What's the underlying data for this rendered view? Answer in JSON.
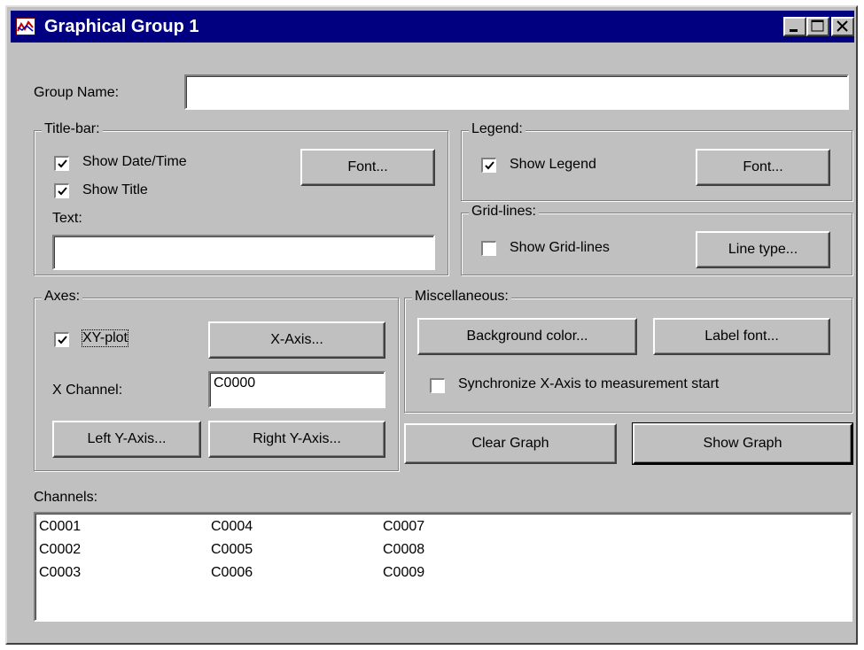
{
  "window": {
    "title": "Graphical Group 1",
    "minimize": "_",
    "maximize": "□",
    "close": "×"
  },
  "group_name": {
    "label": "Group Name:",
    "value": ""
  },
  "titlebar_group": {
    "title": "Title-bar:",
    "show_datetime": {
      "label": "Show Date/Time",
      "checked": true
    },
    "show_title": {
      "label": "Show Title",
      "checked": true
    },
    "text_label": "Text:",
    "text_value": "",
    "font_button": "Font..."
  },
  "legend_group": {
    "title": "Legend:",
    "show_legend": {
      "label": "Show Legend",
      "checked": true
    },
    "font_button": "Font..."
  },
  "gridlines_group": {
    "title": "Grid-lines:",
    "show_gridlines": {
      "label": "Show Grid-lines",
      "checked": false
    },
    "linetype_button": "Line type..."
  },
  "axes_group": {
    "title": "Axes:",
    "xy_plot": {
      "label": "XY-plot",
      "checked": true
    },
    "xaxis_button": "X-Axis...",
    "x_channel_label": "X Channel:",
    "x_channel_value": "C0000",
    "left_y_button": "Left Y-Axis...",
    "right_y_button": "Right Y-Axis..."
  },
  "misc_group": {
    "title": "Miscellaneous:",
    "background_button": "Background color...",
    "label_font_button": "Label font...",
    "synchronize": {
      "label": "Synchronize X-Axis to measurement start",
      "checked": false
    }
  },
  "buttons": {
    "clear_graph": "Clear Graph",
    "show_graph": "Show Graph"
  },
  "channels": {
    "label": "Channels:",
    "items": [
      "C0001",
      "C0002",
      "C0003",
      "C0004",
      "C0005",
      "C0006",
      "C0007",
      "C0008",
      "C0009"
    ]
  }
}
